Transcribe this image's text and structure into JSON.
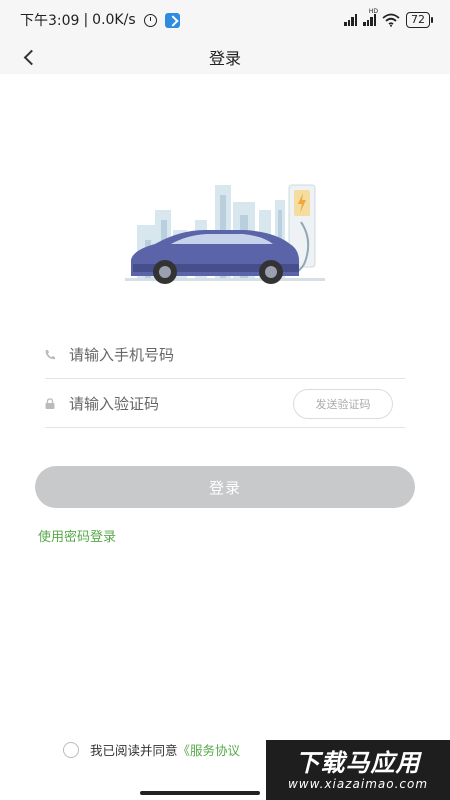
{
  "status_bar": {
    "time": "下午3:09",
    "speed": "0.0K/s",
    "network_tag": "HD",
    "battery": "72"
  },
  "nav": {
    "title": "登录"
  },
  "form": {
    "phone_placeholder": "请输入手机号码",
    "code_placeholder": "请输入验证码",
    "send_code_label": "发送验证码"
  },
  "login_button": "登录",
  "password_login_link": "使用密码登录",
  "agreement": {
    "prefix": "我已阅读并同意",
    "service_link": "《服务协议"
  },
  "watermark": {
    "title": "下载马应用",
    "url": "www.xiazaimao.com"
  },
  "colors": {
    "accent_green": "#57a84a",
    "button_disabled": "#c8c9cb",
    "car_body": "#5b64a8"
  }
}
